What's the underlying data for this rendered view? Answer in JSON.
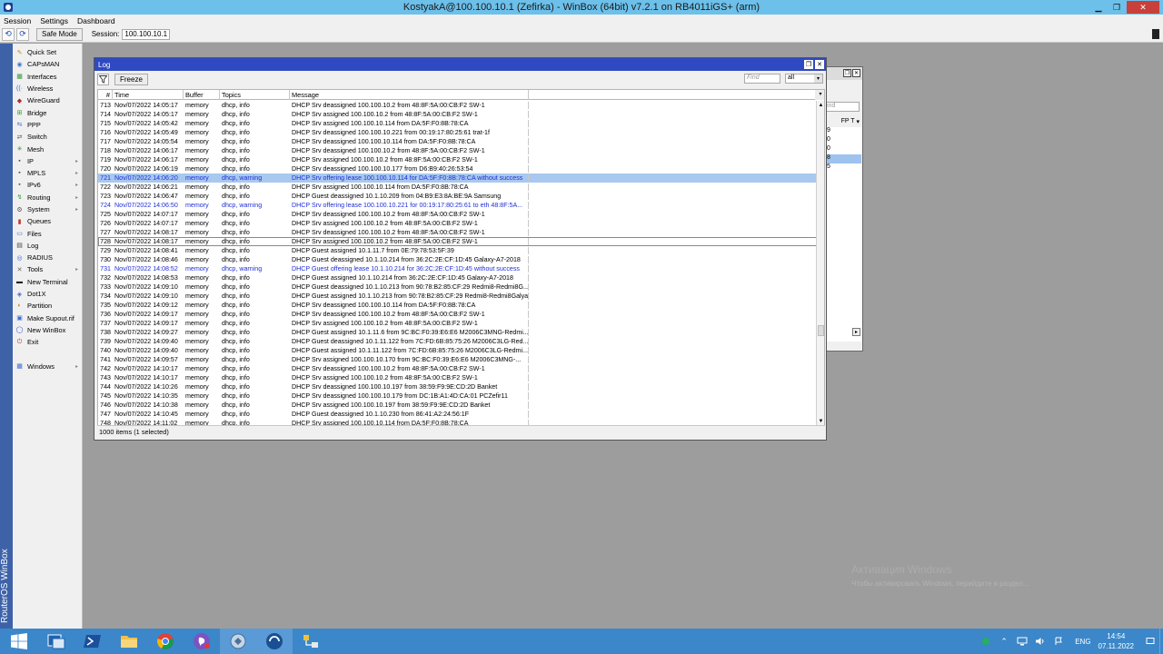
{
  "window": {
    "title": "KostyakA@100.100.10.1 (Zefirka) - WinBox (64bit) v7.2.1 on RB4011iGS+ (arm)",
    "minimize": "▁",
    "maximize": "❐",
    "close": "✕"
  },
  "menu": [
    "Session",
    "Settings",
    "Dashboard"
  ],
  "toolbar": {
    "undo_icon": "⟲",
    "redo_icon": "⟳",
    "safe_mode": "Safe Mode",
    "session_label": "Session:",
    "session_value": "100.100.10.1"
  },
  "vertical_label": "RouterOS WinBox",
  "sidebar": [
    {
      "label": "Quick Set",
      "icon": "quick-set-icon",
      "color": "#c08a2a",
      "sub": false
    },
    {
      "label": "CAPsMAN",
      "icon": "capsman-icon",
      "color": "#4a7ac9",
      "sub": false
    },
    {
      "label": "Interfaces",
      "icon": "interfaces-icon",
      "color": "#2f9a3a",
      "sub": false
    },
    {
      "label": "Wireless",
      "icon": "wireless-icon",
      "color": "#3c6ad1",
      "sub": false
    },
    {
      "label": "WireGuard",
      "icon": "wireguard-icon",
      "color": "#b02c2c",
      "sub": false
    },
    {
      "label": "Bridge",
      "icon": "bridge-icon",
      "color": "#2f9a3a",
      "sub": false
    },
    {
      "label": "PPP",
      "icon": "ppp-icon",
      "color": "#3c6ad1",
      "sub": false
    },
    {
      "label": "Switch",
      "icon": "switch-icon",
      "color": "#555555",
      "sub": false
    },
    {
      "label": "Mesh",
      "icon": "mesh-icon",
      "color": "#2f9a3a",
      "sub": false
    },
    {
      "label": "IP",
      "icon": "ip-icon",
      "color": "#555555",
      "sub": true
    },
    {
      "label": "MPLS",
      "icon": "mpls-icon",
      "color": "#555555",
      "sub": true
    },
    {
      "label": "IPv6",
      "icon": "ipv6-icon",
      "color": "#555555",
      "sub": true
    },
    {
      "label": "Routing",
      "icon": "routing-icon",
      "color": "#2f9a3a",
      "sub": true
    },
    {
      "label": "System",
      "icon": "system-icon",
      "color": "#555555",
      "sub": true
    },
    {
      "label": "Queues",
      "icon": "queues-icon",
      "color": "#c0392b",
      "sub": false
    },
    {
      "label": "Files",
      "icon": "files-icon",
      "color": "#3c6ad1",
      "sub": false
    },
    {
      "label": "Log",
      "icon": "log-icon",
      "color": "#444444",
      "sub": false
    },
    {
      "label": "RADIUS",
      "icon": "radius-icon",
      "color": "#3c6ad1",
      "sub": false
    },
    {
      "label": "Tools",
      "icon": "tools-icon",
      "color": "#666666",
      "sub": true
    },
    {
      "label": "New Terminal",
      "icon": "terminal-icon",
      "color": "#222222",
      "sub": false
    },
    {
      "label": "Dot1X",
      "icon": "dot1x-icon",
      "color": "#3c6ad1",
      "sub": false
    },
    {
      "label": "Partition",
      "icon": "partition-icon",
      "color": "#c08a2a",
      "sub": false
    },
    {
      "label": "Make Supout.rif",
      "icon": "supout-icon",
      "color": "#3c6ad1",
      "sub": false
    },
    {
      "label": "New WinBox",
      "icon": "winbox-icon",
      "color": "#2f49c2",
      "sub": false
    },
    {
      "label": "Exit",
      "icon": "exit-icon",
      "color": "#c0392b",
      "sub": false
    }
  ],
  "sidebar_windows": {
    "label": "Windows",
    "icon": "windows-icon",
    "color": "#3c6ad1",
    "sub": true
  },
  "background_window": {
    "find_placeholder": "ind",
    "header": "FP T",
    "cells": [
      "9",
      "0",
      "0",
      "8",
      "5"
    ],
    "selected_index": 3
  },
  "log": {
    "title": "Log",
    "freeze": "Freeze",
    "find_placeholder": "Find",
    "filter_value": "all",
    "columns": [
      "#",
      "Time",
      "Buffer",
      "Topics",
      "Message"
    ],
    "status": "1000 items (1 selected)",
    "rows": [
      {
        "n": "713",
        "time": "Nov/07/2022 14:05:17",
        "buffer": "memory",
        "topics": "dhcp, info",
        "msg": "DHCP Srv deassigned 100.100.10.2 from 48:8F:5A:00:CB:F2 SW-1",
        "warn": false
      },
      {
        "n": "714",
        "time": "Nov/07/2022 14:05:17",
        "buffer": "memory",
        "topics": "dhcp, info",
        "msg": "DHCP Srv assigned 100.100.10.2 from 48:8F:5A:00:CB:F2 SW-1",
        "warn": false
      },
      {
        "n": "715",
        "time": "Nov/07/2022 14:05:42",
        "buffer": "memory",
        "topics": "dhcp, info",
        "msg": "DHCP Srv assigned 100.100.10.114 from DA:5F:F0:8B:78:CA",
        "warn": false
      },
      {
        "n": "716",
        "time": "Nov/07/2022 14:05:49",
        "buffer": "memory",
        "topics": "dhcp, info",
        "msg": "DHCP Srv deassigned 100.100.10.221 from 00:19:17:80:25:61 trat-1f",
        "warn": false
      },
      {
        "n": "717",
        "time": "Nov/07/2022 14:05:54",
        "buffer": "memory",
        "topics": "dhcp, info",
        "msg": "DHCP Srv deassigned 100.100.10.114 from DA:5F:F0:8B:78:CA",
        "warn": false
      },
      {
        "n": "718",
        "time": "Nov/07/2022 14:06:17",
        "buffer": "memory",
        "topics": "dhcp, info",
        "msg": "DHCP Srv deassigned 100.100.10.2 from 48:8F:5A:00:CB:F2 SW-1",
        "warn": false
      },
      {
        "n": "719",
        "time": "Nov/07/2022 14:06:17",
        "buffer": "memory",
        "topics": "dhcp, info",
        "msg": "DHCP Srv assigned 100.100.10.2 from 48:8F:5A:00:CB:F2 SW-1",
        "warn": false
      },
      {
        "n": "720",
        "time": "Nov/07/2022 14:06:19",
        "buffer": "memory",
        "topics": "dhcp, info",
        "msg": "DHCP Srv deassigned 100.100.10.177 from D6:B9:40:26:53:54",
        "warn": false
      },
      {
        "n": "721",
        "time": "Nov/07/2022 14:06:20",
        "buffer": "memory",
        "topics": "dhcp, warning",
        "msg": "DHCP Srv offering lease 100.100.10.114 for DA:5F:F0:8B:78:CA without success",
        "warn": true,
        "sel": true
      },
      {
        "n": "722",
        "time": "Nov/07/2022 14:06:21",
        "buffer": "memory",
        "topics": "dhcp, info",
        "msg": "DHCP Srv assigned 100.100.10.114 from DA:5F:F0:8B:78:CA",
        "warn": false
      },
      {
        "n": "723",
        "time": "Nov/07/2022 14:06:47",
        "buffer": "memory",
        "topics": "dhcp, info",
        "msg": "DHCP Guest deassigned 10.1.10.209 from 04:B9:E3:8A:BE:9A Samsung",
        "warn": false
      },
      {
        "n": "724",
        "time": "Nov/07/2022 14:06:50",
        "buffer": "memory",
        "topics": "dhcp, warning",
        "msg": "DHCP Srv offering lease 100.100.10.221 for 00:19:17:80:25:61 to eth 48:8F:5A...",
        "warn": true
      },
      {
        "n": "725",
        "time": "Nov/07/2022 14:07:17",
        "buffer": "memory",
        "topics": "dhcp, info",
        "msg": "DHCP Srv deassigned 100.100.10.2 from 48:8F:5A:00:CB:F2 SW-1",
        "warn": false
      },
      {
        "n": "726",
        "time": "Nov/07/2022 14:07:17",
        "buffer": "memory",
        "topics": "dhcp, info",
        "msg": "DHCP Srv assigned 100.100.10.2 from 48:8F:5A:00:CB:F2 SW-1",
        "warn": false
      },
      {
        "n": "727",
        "time": "Nov/07/2022 14:08:17",
        "buffer": "memory",
        "topics": "dhcp, info",
        "msg": "DHCP Srv deassigned 100.100.10.2 from 48:8F:5A:00:CB:F2 SW-1",
        "warn": false
      },
      {
        "n": "728",
        "time": "Nov/07/2022 14:08:17",
        "buffer": "memory",
        "topics": "dhcp, info",
        "msg": "DHCP Srv assigned 100.100.10.2 from 48:8F:5A:00:CB:F2 SW-1",
        "warn": false,
        "focus": true
      },
      {
        "n": "729",
        "time": "Nov/07/2022 14:08:41",
        "buffer": "memory",
        "topics": "dhcp, info",
        "msg": "DHCP Guest assigned 10.1.11.7 from 0E:79:78:53:5F:39",
        "warn": false
      },
      {
        "n": "730",
        "time": "Nov/07/2022 14:08:46",
        "buffer": "memory",
        "topics": "dhcp, info",
        "msg": "DHCP Guest deassigned 10.1.10.214 from 36:2C:2E:CF:1D:45 Galaxy-A7-2018",
        "warn": false
      },
      {
        "n": "731",
        "time": "Nov/07/2022 14:08:52",
        "buffer": "memory",
        "topics": "dhcp, warning",
        "msg": "DHCP Guest offering lease 10.1.10.214 for 36:2C:2E:CF:1D:45 without success",
        "warn": true
      },
      {
        "n": "732",
        "time": "Nov/07/2022 14:08:53",
        "buffer": "memory",
        "topics": "dhcp, info",
        "msg": "DHCP Guest assigned 10.1.10.214 from 36:2C:2E:CF:1D:45 Galaxy-A7-2018",
        "warn": false
      },
      {
        "n": "733",
        "time": "Nov/07/2022 14:09:10",
        "buffer": "memory",
        "topics": "dhcp, info",
        "msg": "DHCP Guest deassigned 10.1.10.213 from 90:78:B2:85:CF:29 Redmi8-Redmi8G...",
        "warn": false
      },
      {
        "n": "734",
        "time": "Nov/07/2022 14:09:10",
        "buffer": "memory",
        "topics": "dhcp, info",
        "msg": "DHCP Guest assigned 10.1.10.213 from 90:78:B2:85:CF:29 Redmi8-Redmi8Galya",
        "warn": false
      },
      {
        "n": "735",
        "time": "Nov/07/2022 14:09:12",
        "buffer": "memory",
        "topics": "dhcp, info",
        "msg": "DHCP Srv deassigned 100.100.10.114 from DA:5F:F0:8B:78:CA",
        "warn": false
      },
      {
        "n": "736",
        "time": "Nov/07/2022 14:09:17",
        "buffer": "memory",
        "topics": "dhcp, info",
        "msg": "DHCP Srv deassigned 100.100.10.2 from 48:8F:5A:00:CB:F2 SW-1",
        "warn": false
      },
      {
        "n": "737",
        "time": "Nov/07/2022 14:09:17",
        "buffer": "memory",
        "topics": "dhcp, info",
        "msg": "DHCP Srv assigned 100.100.10.2 from 48:8F:5A:00:CB:F2 SW-1",
        "warn": false
      },
      {
        "n": "738",
        "time": "Nov/07/2022 14:09:27",
        "buffer": "memory",
        "topics": "dhcp, info",
        "msg": "DHCP Guest assigned 10.1.11.6 from 9C:BC:F0:39:E6:E6 M2006C3MNG-Redmi...",
        "warn": false
      },
      {
        "n": "739",
        "time": "Nov/07/2022 14:09:40",
        "buffer": "memory",
        "topics": "dhcp, info",
        "msg": "DHCP Guest deassigned 10.1.11.122 from 7C:FD:6B:85:75:26 M2006C3LG-Red...",
        "warn": false
      },
      {
        "n": "740",
        "time": "Nov/07/2022 14:09:40",
        "buffer": "memory",
        "topics": "dhcp, info",
        "msg": "DHCP Guest assigned 10.1.11.122 from 7C:FD:6B:85:75:26 M2006C3LG-Redmi...",
        "warn": false
      },
      {
        "n": "741",
        "time": "Nov/07/2022 14:09:57",
        "buffer": "memory",
        "topics": "dhcp, info",
        "msg": "DHCP Srv assigned 100.100.10.170 from 9C:BC:F0:39:E6:E6 M2006C3MNG-...",
        "warn": false
      },
      {
        "n": "742",
        "time": "Nov/07/2022 14:10:17",
        "buffer": "memory",
        "topics": "dhcp, info",
        "msg": "DHCP Srv deassigned 100.100.10.2 from 48:8F:5A:00:CB:F2 SW-1",
        "warn": false
      },
      {
        "n": "743",
        "time": "Nov/07/2022 14:10:17",
        "buffer": "memory",
        "topics": "dhcp, info",
        "msg": "DHCP Srv assigned 100.100.10.2 from 48:8F:5A:00:CB:F2 SW-1",
        "warn": false
      },
      {
        "n": "744",
        "time": "Nov/07/2022 14:10:26",
        "buffer": "memory",
        "topics": "dhcp, info",
        "msg": "DHCP Srv deassigned 100.100.10.197 from 38:59:F9:9E:CD:2D Banket",
        "warn": false
      },
      {
        "n": "745",
        "time": "Nov/07/2022 14:10:35",
        "buffer": "memory",
        "topics": "dhcp, info",
        "msg": "DHCP Srv deassigned 100.100.10.179 from DC:1B:A1:4D:CA:01 PCZefir11",
        "warn": false
      },
      {
        "n": "746",
        "time": "Nov/07/2022 14:10:38",
        "buffer": "memory",
        "topics": "dhcp, info",
        "msg": "DHCP Srv assigned 100.100.10.197 from 38:59:F9:9E:CD:2D Banket",
        "warn": false
      },
      {
        "n": "747",
        "time": "Nov/07/2022 14:10:45",
        "buffer": "memory",
        "topics": "dhcp, info",
        "msg": "DHCP Guest deassigned 10.1.10.230 from 86:41:A2:24:56:1F",
        "warn": false
      },
      {
        "n": "748",
        "time": "Nov/07/2022 14:11:02",
        "buffer": "memory",
        "topics": "dhcp, info",
        "msg": "DHCP Srv assigned 100.100.10.114 from DA:5F:F0:8B:78:CA",
        "warn": false
      }
    ]
  },
  "watermark": {
    "title": "Активация Windows",
    "sub": "Чтобы активировать Windows, перейдите в раздел..."
  },
  "taskbar": {
    "apps": [
      "server-manager",
      "powershell",
      "file-explorer",
      "chrome",
      "viber",
      "winbox",
      "anydesk",
      "network-tool"
    ],
    "tray_lang": "ENG",
    "time": "14:54",
    "date": "07.11.2022"
  }
}
